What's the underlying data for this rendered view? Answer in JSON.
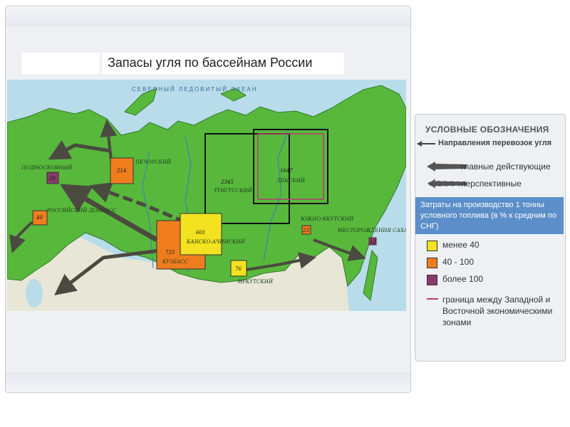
{
  "map": {
    "title": "Запасы  угля по бассейнам России",
    "ocean_label": "СЕВЕРНЫЙ ЛЕДОВИТЫЙ ОКЕАН"
  },
  "basins": [
    {
      "name": "ПЕЧОРСКИЙ",
      "value": "214",
      "cost": "40 - 100"
    },
    {
      "name": "ПОДМОСКОВНЫЙ",
      "value": "20",
      "cost": "более 100"
    },
    {
      "name": "РОССИЙСКИЙ ДОНБАСС",
      "value": "40",
      "cost": "40 - 100"
    },
    {
      "name": "КУЗБАСС",
      "value": "725",
      "cost": "40 - 100"
    },
    {
      "name": "КАНСКО-АЧИНСКИЙ",
      "value": "601",
      "cost": "менее 40"
    },
    {
      "name": "ТУНГУССКИЙ",
      "value": "2345",
      "cost": ""
    },
    {
      "name": "ЛЕНСКИЙ",
      "value": "1647",
      "cost": ""
    },
    {
      "name": "ИРКУТСКИЙ",
      "value": "76",
      "cost": "менее 40"
    },
    {
      "name": "ЮЖНО-ЯКУТСКИЙ",
      "value": "23",
      "cost": "40 - 100"
    },
    {
      "name": "МЕСТОРОЖДЕНИЯ САХАЛИНА",
      "value": "12",
      "cost": "более 100"
    }
  ],
  "legend": {
    "title": "УСЛОВНЫЕ ОБОЗНАЧЕНИЯ",
    "transport_header": "Направления перевозок угля",
    "main_active": "главные действующие",
    "prospective": "перспективные",
    "cost_header": "Затраты на производство 1 тонны условного топлива (в % к средним по СНГ)",
    "less_40": "менее 40",
    "from_40_100": "40 - 100",
    "more_100": "более 100",
    "border_line": "граница между Западной и Восточной экономическими зонами"
  },
  "colors": {
    "yellow": "#f2e21f",
    "orange": "#ef7d1e",
    "purple": "#8a3a6a",
    "border_line": "#b83c6e",
    "land": "#58b83c",
    "water": "#b8dcea",
    "legend_blue": "#5c8fc9"
  }
}
